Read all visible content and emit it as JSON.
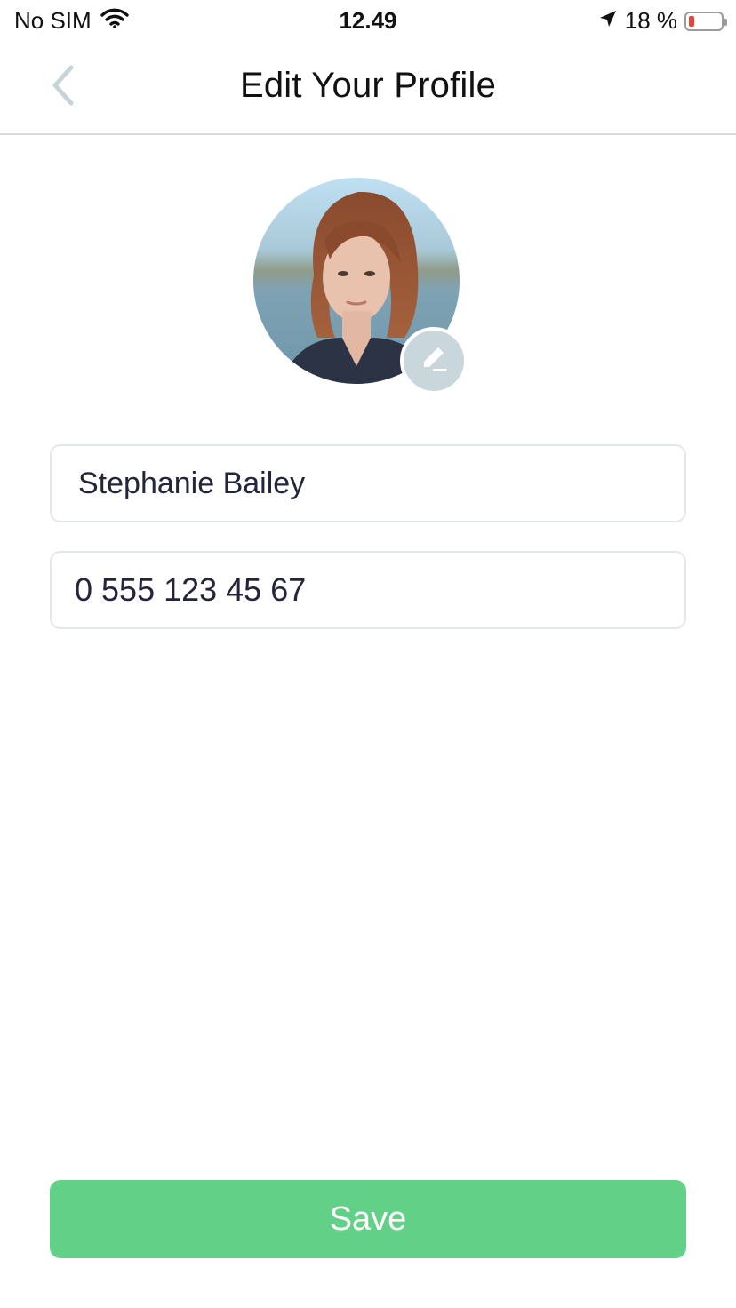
{
  "status_bar": {
    "carrier": "No SIM",
    "time": "12.49",
    "battery_text": "18 %",
    "battery_level": 0.18,
    "battery_color": "#e8403c"
  },
  "header": {
    "title": "Edit Your Profile",
    "back_icon": "chevron-left-icon"
  },
  "profile": {
    "avatar_icon": "profile-photo",
    "edit_icon": "pencil-icon"
  },
  "form": {
    "name_value": "Stephanie Bailey",
    "phone_value": "0 555 123 45 67"
  },
  "actions": {
    "save_label": "Save",
    "save_color": "#62d187"
  }
}
